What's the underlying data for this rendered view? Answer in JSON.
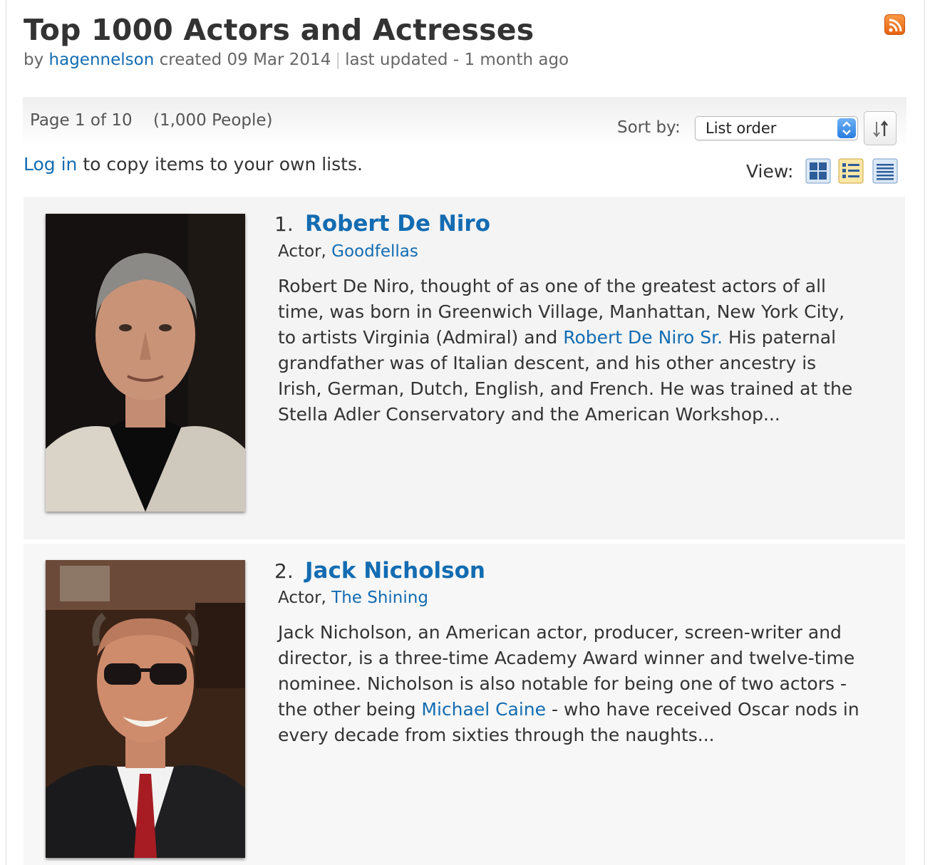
{
  "header": {
    "title": "Top 1000 Actors and Actresses",
    "by_prefix": "by",
    "author": "hagennelson",
    "created_text": "created 09 Mar 2014",
    "separator": "|",
    "updated_text": "last updated - 1 month ago"
  },
  "toolbar": {
    "page_text": "Page 1 of 10",
    "count_text": "(1,000 People)",
    "sort_label": "Sort by:",
    "sort_value": "List order",
    "login_link": "Log in",
    "login_rest": "to copy items to your own lists.",
    "view_label": "View:"
  },
  "icons": {
    "rss": "rss-feed-icon",
    "sort_direction": "sort-direction-icon",
    "view_grid": "grid-view-icon",
    "view_detail": "detail-view-icon",
    "view_compact": "compact-view-icon"
  },
  "colors": {
    "link": "#136cb2",
    "text": "#333333",
    "item_bg": "#f4f4f4",
    "rss": "#f08a2c"
  },
  "items": [
    {
      "rank": "1.",
      "name": "Robert De Niro",
      "role_prefix": "Actor,",
      "known_for": "Goodfellas",
      "desc": {
        "l1": "Robert De Niro, thought of as one of the greatest actors of all",
        "l2": "time, was born in Greenwich Village, Manhattan, New York City,",
        "l3_a": "to artists Virginia (Admiral) and",
        "l3_link": "Robert De Niro Sr.",
        "l3_b": "His paternal",
        "l4": "grandfather was of Italian descent, and his other ancestry is",
        "l5": "Irish, German, Dutch, English, and French. He was trained at the",
        "l6": "Stella Adler Conservatory and the American Workshop..."
      }
    },
    {
      "rank": "2.",
      "name": "Jack Nicholson",
      "role_prefix": "Actor,",
      "known_for": "The Shining",
      "desc": {
        "l1": "Jack Nicholson, an American actor, producer, screen-writer and",
        "l2": "director, is a three-time Academy Award winner and twelve-time",
        "l3": "nominee. Nicholson is also notable for being one of two actors -",
        "l4_a": "the other being",
        "l4_link": "Michael Caine",
        "l4_b": "- who have received Oscar nods in",
        "l5": "every decade from sixties through the naughts..."
      }
    }
  ]
}
